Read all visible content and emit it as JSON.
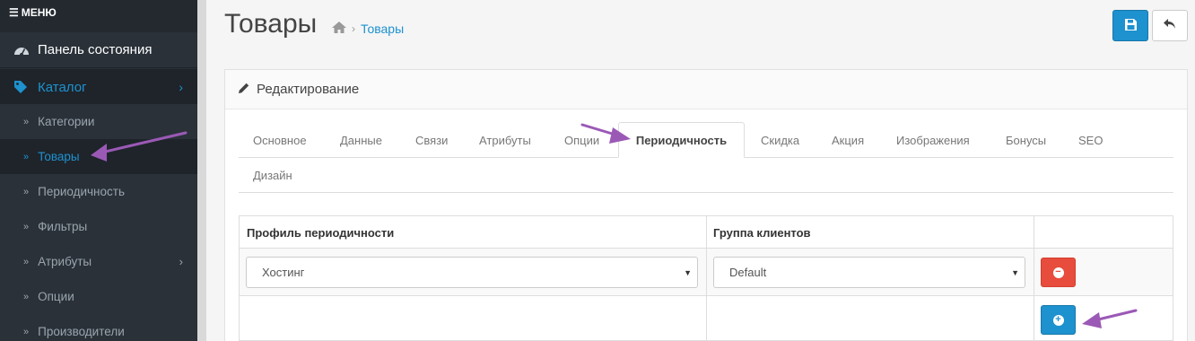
{
  "sidebar": {
    "menu_label": "МЕНЮ",
    "dashboard": "Панель состояния",
    "catalog": "Каталог",
    "sub_items": [
      "Категории",
      "Товары",
      "Периодичность",
      "Фильтры",
      "Атрибуты",
      "Опции",
      "Производители"
    ]
  },
  "header": {
    "title": "Товары",
    "breadcrumb_current": "Товары"
  },
  "panel": {
    "heading": "Редактирование",
    "tabs": [
      "Основное",
      "Данные",
      "Связи",
      "Атрибуты",
      "Опции",
      "Периодичность",
      "Скидка",
      "Акция",
      "Изображения",
      "Бонусы",
      "SEO",
      "Дизайн"
    ],
    "active_tab": "Периодичность"
  },
  "table": {
    "headers": [
      "Профиль периодичности",
      "Группа клиентов"
    ],
    "rows": [
      {
        "profile": "Хостинг",
        "customer_group": "Default"
      }
    ]
  },
  "colors": {
    "accent": "#1e91cf",
    "danger": "#e74c3c",
    "sidebar": "#2a3139",
    "annotation_arrow": "#9b59b6"
  }
}
